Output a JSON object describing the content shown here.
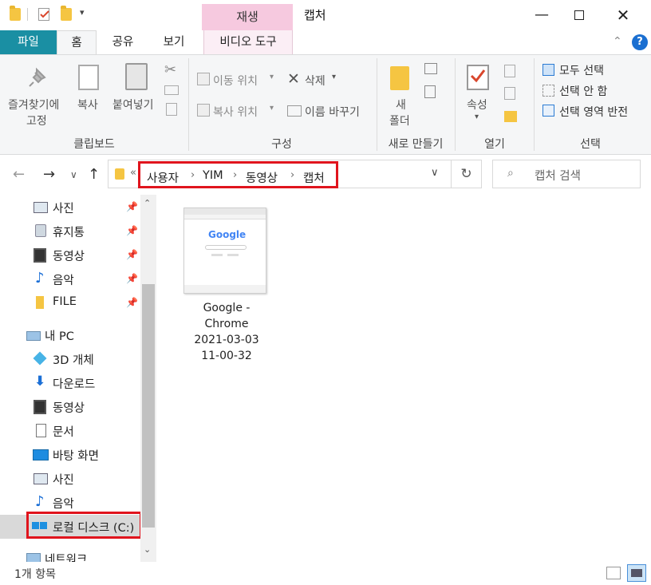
{
  "titlebar": {
    "context_tab": "재생",
    "window_title": "캡처",
    "minimize_icon": "minimize-icon",
    "maximize_icon": "maximize-icon",
    "close_icon": "close-icon"
  },
  "tabs": {
    "file": "파일",
    "home": "홈",
    "share": "공유",
    "view": "보기",
    "video_tools": "비디오 도구"
  },
  "ribbon": {
    "clipboard": {
      "pin_line1": "즐겨찾기에",
      "pin_line2": "고정",
      "copy": "복사",
      "paste": "붙여넣기",
      "group": "클립보드"
    },
    "organize": {
      "move_to": "이동 위치",
      "copy_to": "복사 위치",
      "delete": "삭제",
      "rename": "이름 바꾸기",
      "group": "구성"
    },
    "new": {
      "new_folder_line1": "새",
      "new_folder_line2": "폴더",
      "group": "새로 만들기"
    },
    "open": {
      "properties": "속성",
      "group": "열기"
    },
    "select": {
      "select_all": "모두 선택",
      "select_none": "선택 안 함",
      "invert": "선택 영역 반전",
      "group": "선택"
    }
  },
  "address": {
    "overflow": "«",
    "crumbs": [
      "사용자",
      "YIM",
      "동영상",
      "캡처"
    ],
    "search_placeholder": "캡처 검색"
  },
  "nav": {
    "quick": [
      {
        "label": "사진",
        "pinned": true
      },
      {
        "label": "휴지통",
        "pinned": true
      },
      {
        "label": "동영상",
        "pinned": true
      },
      {
        "label": "음악",
        "pinned": true
      },
      {
        "label": "FILE",
        "pinned": true
      }
    ],
    "pc": "내 PC",
    "pc_items": [
      "3D 개체",
      "다운로드",
      "동영상",
      "문서",
      "바탕 화면",
      "사진",
      "음악",
      "로컬 디스크 (C:)"
    ],
    "network": "네트워크"
  },
  "files": [
    {
      "name_lines": [
        "Google -",
        "Chrome",
        "2021-03-03",
        "11-00-32"
      ],
      "thumb_logo": "Google"
    }
  ],
  "status": {
    "count": "1개 항목"
  },
  "colors": {
    "file_tab": "#1a8fa3",
    "context_tab": "#f6c9df",
    "highlight": "#e0141d"
  }
}
